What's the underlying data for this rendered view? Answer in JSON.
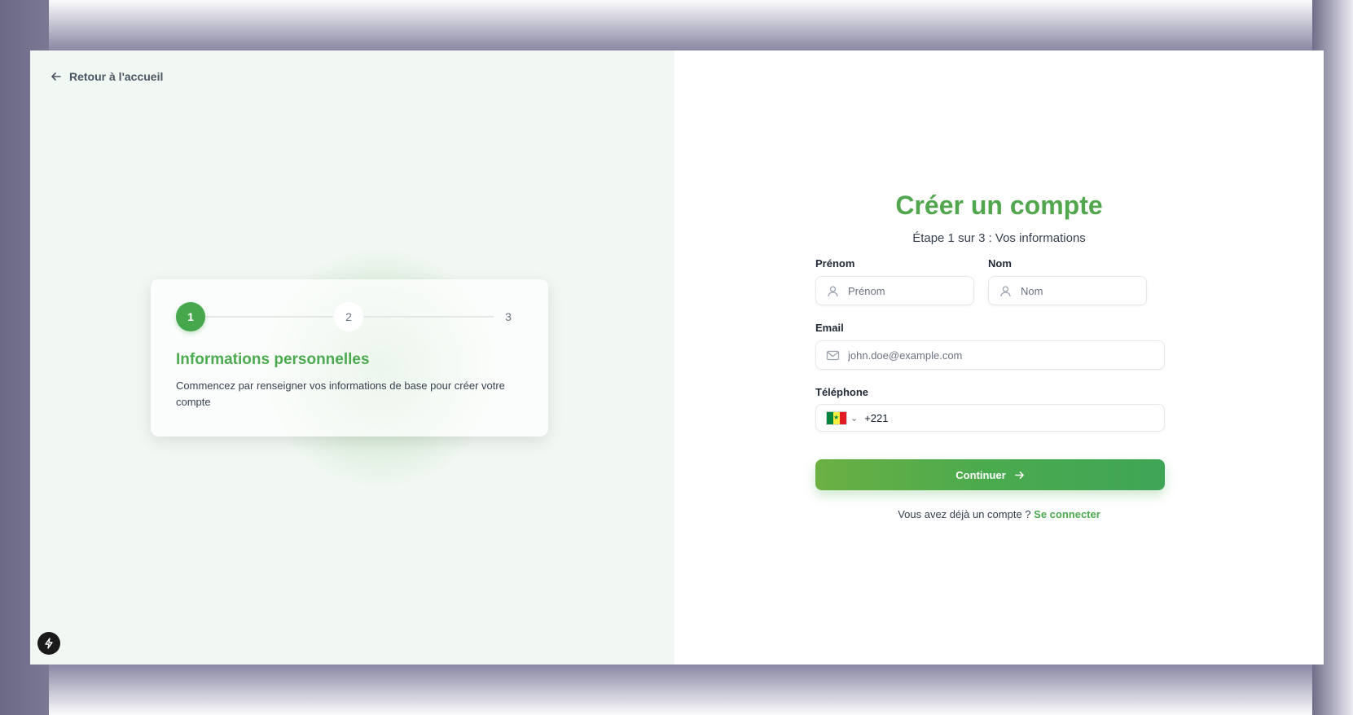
{
  "nav": {
    "back_label": "Retour à l'accueil"
  },
  "stepper": {
    "steps": [
      "1",
      "2",
      "3"
    ],
    "active_step": 1,
    "card_title": "Informations personnelles",
    "card_description": "Commencez par renseigner vos informations de base pour créer votre compte"
  },
  "form": {
    "title": "Créer un compte",
    "subtitle": "Étape 1 sur 3 : Vos informations",
    "first_name": {
      "label": "Prénom",
      "placeholder": "Prénom",
      "value": ""
    },
    "last_name": {
      "label": "Nom",
      "placeholder": "Nom",
      "value": ""
    },
    "email": {
      "label": "Email",
      "placeholder": "john.doe@example.com",
      "value": ""
    },
    "phone": {
      "label": "Téléphone",
      "country_flag": "senegal-flag-icon",
      "dial_code": "+221"
    },
    "submit_label": "Continuer",
    "login_prompt": "Vous avez déjà un compte ?",
    "login_link": "Se connecter"
  },
  "colors": {
    "accent": "#4caa4f",
    "button_gradient_start": "#6bb043",
    "button_gradient_end": "#3fa556",
    "left_panel_bg": "#f1f7f2"
  },
  "icons": [
    "arrow-left-icon",
    "user-icon",
    "mail-icon",
    "chevron-down-icon",
    "arrow-right-icon",
    "lightning-icon"
  ]
}
